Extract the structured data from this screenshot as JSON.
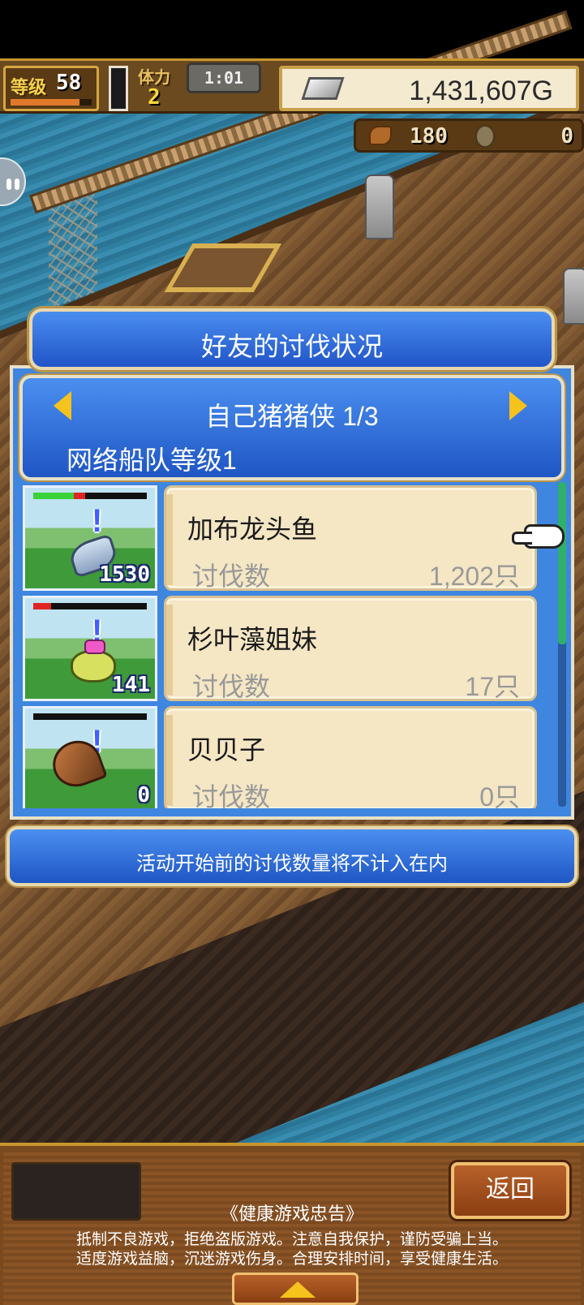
{
  "hud": {
    "level_label": "等级",
    "level_value": "58",
    "level_progress": 0.85,
    "stamina_label": "体力",
    "stamina_value": "2",
    "timer": "1:01",
    "gold": "1,431,607G",
    "food_value": "180",
    "medal_value": "0"
  },
  "modal": {
    "title": "好友的讨伐状况",
    "page_label": "自己猪猪侠 1/3",
    "fleet_label": "网络船队等级1",
    "notice": "活动开始前的讨伐数量将不计入在内"
  },
  "monsters": [
    {
      "name": "加布龙头鱼",
      "defeat_label": "讨伐数",
      "defeat_value": "1,202只",
      "thumb_count": "1530",
      "sprite": "fish-icon",
      "hp_green": 0.36,
      "hp_red": 0.1
    },
    {
      "name": "杉叶藻姐妹",
      "defeat_label": "讨伐数",
      "defeat_value": "17只",
      "thumb_count": "141",
      "sprite": "seaweed-icon",
      "hp_green": 0.0,
      "hp_red": 0.16
    },
    {
      "name": "贝贝子",
      "defeat_label": "讨伐数",
      "defeat_value": "0只",
      "thumb_count": "0",
      "sprite": "shell-icon",
      "hp_green": 0.0,
      "hp_red": 0.0
    }
  ],
  "bottom": {
    "back_label": "返回",
    "health_title": "《健康游戏忠告》",
    "health_line1": "抵制不良游戏，拒绝盗版游戏。注意自我保护，谨防受骗上当。",
    "health_line2": "适度游戏益脑，沉迷游戏伤身。合理安排时间，享受健康生活。"
  },
  "colors": {
    "panel_blue": "#3e86e0",
    "card_bg": "#f5e6c4",
    "accent_gold": "#f6c21c"
  }
}
